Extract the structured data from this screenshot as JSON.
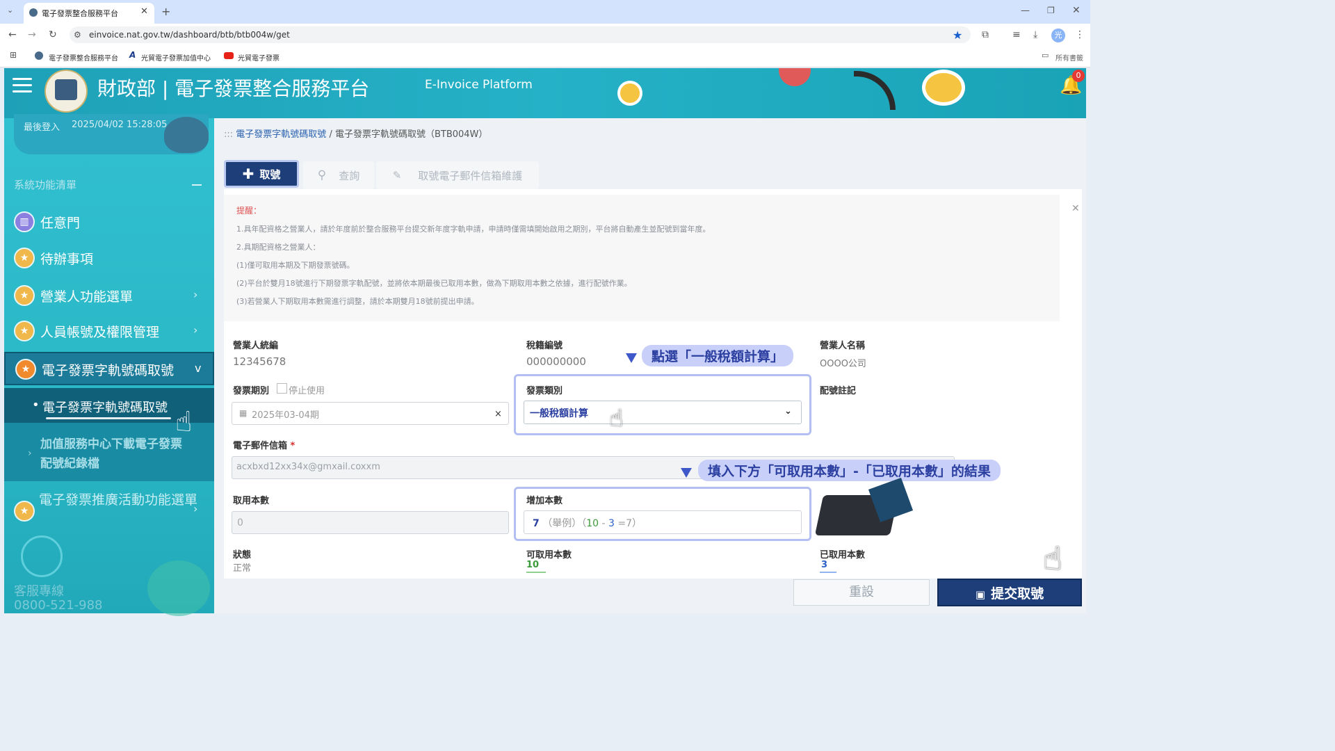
{
  "browser": {
    "tab_title": "電子發票整合服務平台",
    "url": "einvoice.nat.gov.tw/dashboard/btb/btb004w/get",
    "bookmarks": [
      "電子發票整合服務平台",
      "光貿電子發票加值中心",
      "光貿電子發票"
    ],
    "all_bookmarks": "所有書籤",
    "profile_initial": "光"
  },
  "header": {
    "title": "財政部 | 電子發票整合服務平台",
    "subtitle": "E-Invoice Platform",
    "notification_count": "0"
  },
  "sidebar": {
    "last_login_label": "最後登入",
    "last_login_value": "2025/04/02  15:28:05",
    "section_title": "系統功能清單",
    "items": [
      {
        "label": "任意門"
      },
      {
        "label": "待辦事項"
      },
      {
        "label": "營業人功能選單"
      },
      {
        "label": "人員帳號及權限管理"
      },
      {
        "label": "電子發票字軌號碼取號"
      }
    ],
    "sub_active": "電子發票字軌號碼取號",
    "sub_item2_line1": "加值服務中心下載電子發票",
    "sub_item2_line2": "配號紀錄檔",
    "promo": "電子發票推廣活動功能選單",
    "service_label": "客服專線",
    "service_phone": "0800-521-988"
  },
  "breadcrumb": {
    "prefix": ":::",
    "parent": "電子發票字軌號碼取號",
    "current": "電子發票字軌號碼取號（BTB004W）"
  },
  "tabs": {
    "get": "取號",
    "query": "查詢",
    "mail": "取號電子郵件信箱維護"
  },
  "notice": {
    "title": "提醒：",
    "lines": [
      "1.具年配資格之營業人，請於年度前於整合服務平台提交新年度字軌申請，申請時僅需填開始啟用之期別，平台將自動產生並配號到當年度。",
      "2.具期配資格之營業人：",
      "(1)僅可取用本期及下期發票號碼。",
      "(2)平台於雙月18號進行下期發票字軌配號，並將依本期最後已取用本數，做為下期取用本數之依據，進行配號作業。",
      "(3)若營業人下期取用本數需進行調整，請於本期雙月18號前提出申請。"
    ]
  },
  "form": {
    "ban_label": "營業人統編",
    "ban_value": "12345678",
    "tax_label": "稅籍編號",
    "tax_value": "000000000",
    "name_label": "營業人名稱",
    "name_value": "OOOO公司",
    "period_label": "發票期別",
    "stop_label": "停止使用",
    "period_value": "2025年03-04期",
    "type_label": "發票類別",
    "type_value": "一般稅額計算",
    "note_label": "配號註記",
    "email_label": "電子郵件信箱",
    "email_value": "acxbxd12xx34x@gmxail.coxxm",
    "take_label": "取用本數",
    "take_value": "0",
    "add_label": "增加本數",
    "add_value": "7",
    "add_hint": "（舉例）（",
    "add_hint_a": "10",
    "add_hint_minus": " - ",
    "add_hint_b": "3",
    "add_hint_eq": " =7）",
    "status_label": "狀態",
    "status_value": "正常",
    "avail_label": "可取用本數",
    "avail_value": "10",
    "used_label": "已取用本數",
    "used_value": "3"
  },
  "callouts": {
    "select_type": "點選「一般稅額計算」",
    "fill_result": "填入下方「可取用本數」-「已取用本數」的結果"
  },
  "buttons": {
    "reset": "重設",
    "submit": "提交取號"
  },
  "colors": {
    "header": "#25b1c7",
    "primary": "#1d3e79",
    "callout_bg": "#c8cff8"
  }
}
